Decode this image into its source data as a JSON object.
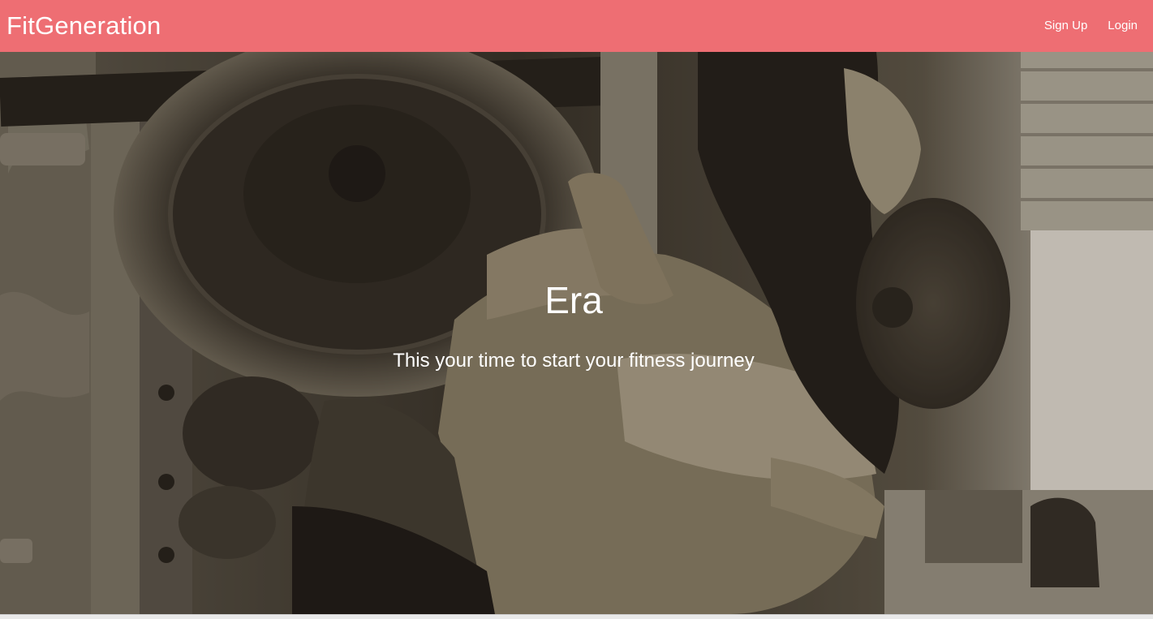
{
  "navbar": {
    "brand": "FitGeneration",
    "links": [
      {
        "label": "Sign Up"
      },
      {
        "label": "Login"
      }
    ],
    "background_color": "#ee6e73"
  },
  "hero": {
    "title": "Era",
    "subtitle": "This your time to start your fitness journey",
    "image": "gym-barbell-squat-photo",
    "image_tone": "sepia"
  }
}
